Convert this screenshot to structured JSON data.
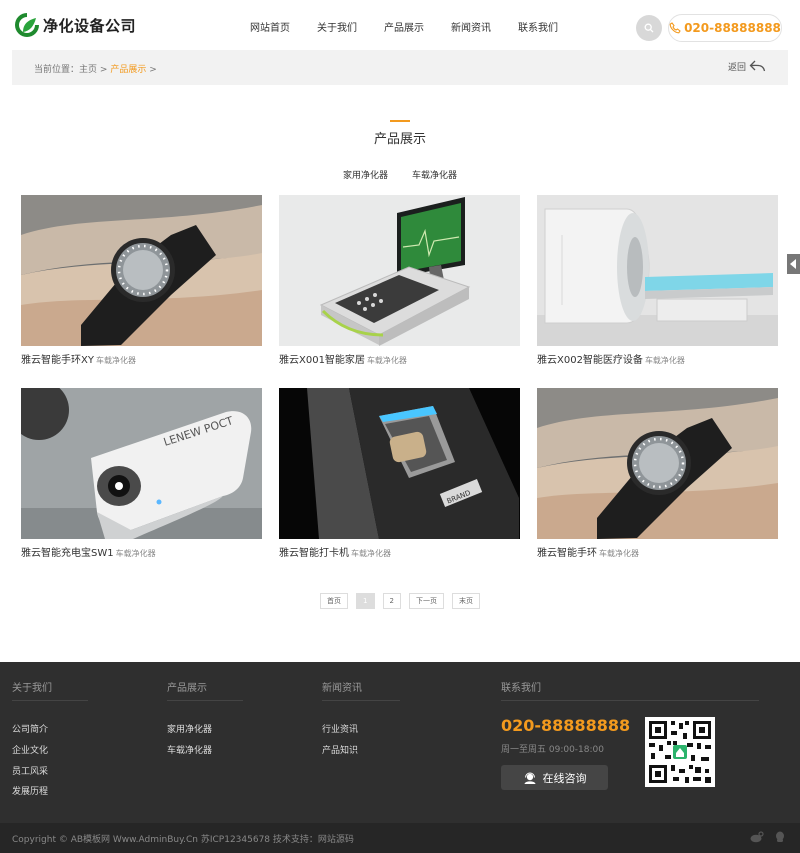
{
  "brand": {
    "name": "净化设备公司",
    "accent": "#f39a1e",
    "logo_color": "#1f8a2e"
  },
  "nav": [
    "网站首页",
    "关于我们",
    "产品展示",
    "新闻资讯",
    "联系我们"
  ],
  "header": {
    "search_icon": "search-icon",
    "phone": "020-88888888"
  },
  "breadcrumb": {
    "prefix": "当前位置：",
    "home": "主页",
    "sep": ">",
    "current": "产品展示",
    "back": "返回"
  },
  "section": {
    "title": "产品展示",
    "categories": [
      "家用净化器",
      "车载净化器"
    ]
  },
  "products": [
    {
      "name": "雅云智能手环XY",
      "tag": "车载净化器",
      "image": "smartwatch-on-wrist"
    },
    {
      "name": "雅云X001智能家居",
      "tag": "车载净化器",
      "image": "medical-monitor-device"
    },
    {
      "name": "雅云X002智能医疗设备",
      "tag": "车载净化器",
      "image": "ct-scanner"
    },
    {
      "name": "雅云智能充电宝SW1",
      "tag": "车载净化器",
      "image": "white-handheld-device",
      "device_print": "LENEW POCT"
    },
    {
      "name": "雅云智能打卡机",
      "tag": "车载净化器",
      "image": "fingerprint-scanner",
      "device_print": "BRAND"
    },
    {
      "name": "雅云智能手环",
      "tag": "车载净化器",
      "image": "smartwatch-on-wrist"
    }
  ],
  "pagination": {
    "first": "首页",
    "pages": [
      "1",
      "2"
    ],
    "current": "1",
    "next": "下一页",
    "last": "末页"
  },
  "footer": {
    "about": {
      "title": "关于我们",
      "links": [
        "公司简介",
        "企业文化",
        "员工风采",
        "发展历程"
      ]
    },
    "products": {
      "title": "产品展示",
      "links": [
        "家用净化器",
        "车载净化器"
      ]
    },
    "news": {
      "title": "新闻资讯",
      "links": [
        "行业资讯",
        "产品知识"
      ]
    },
    "contact": {
      "title": "联系我们",
      "phone": "020-88888888",
      "hours": "周一至周五 09:00-18:00",
      "consult": "在线咨询"
    },
    "copyright": "Copyright © AB模板网 Www.AdminBuy.Cn   苏ICP12345678   技术支持：网站源码"
  }
}
